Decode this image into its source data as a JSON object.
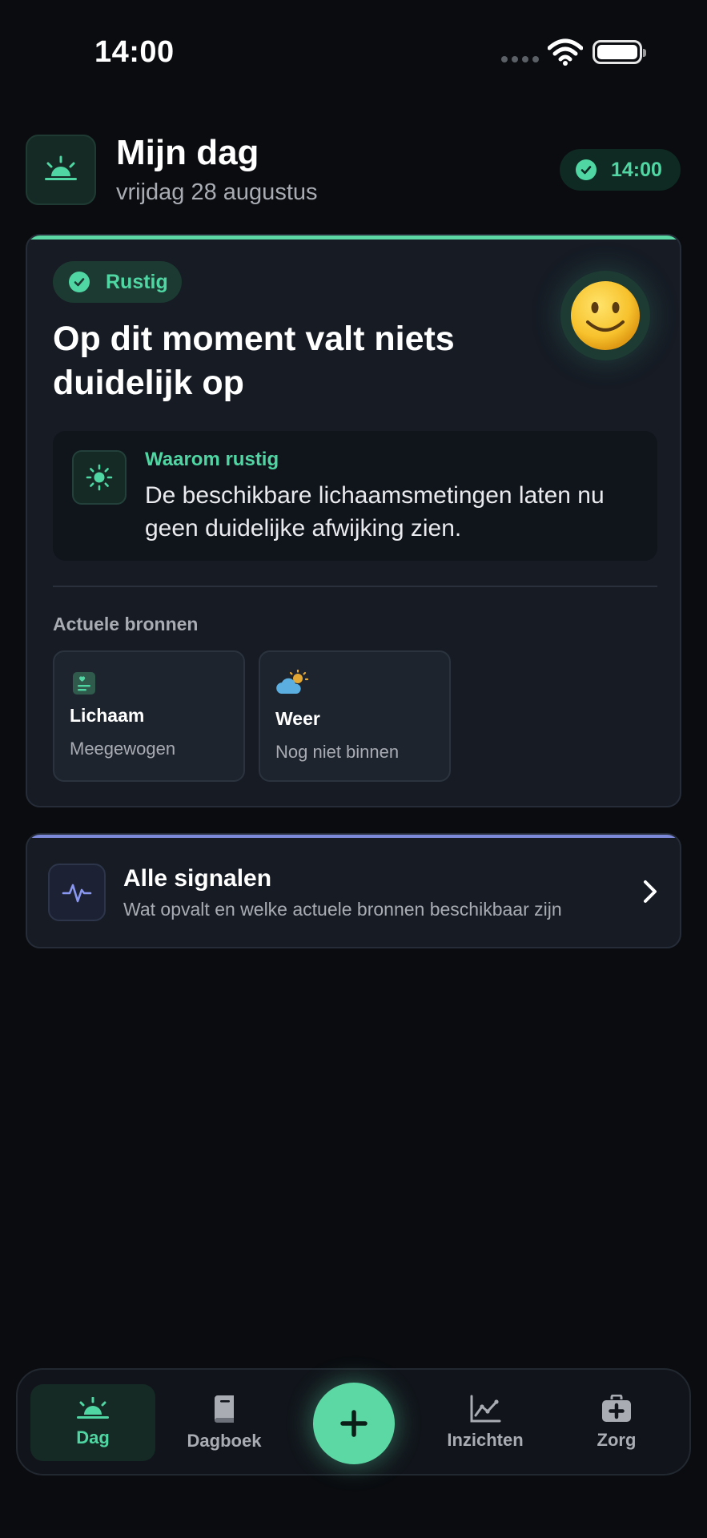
{
  "status_bar": {
    "time": "14:00"
  },
  "header": {
    "title": "Mijn dag",
    "date": "vrijdag 28 augustus",
    "time_badge": "14:00",
    "icon": "sunrise-icon"
  },
  "status_card": {
    "badge": "Rustig",
    "headline": "Op dit moment valt niets duidelijk op",
    "emoji": "🙂",
    "accent_color": "#5cd8a5",
    "why": {
      "title": "Waarom rustig",
      "text": "De beschikbare lichaamsmetingen laten nu geen duidelijke afwijking zien.",
      "icon": "sun-icon"
    },
    "sources_label": "Actuele bronnen",
    "sources": [
      {
        "title": "Lichaam",
        "status": "Meegewogen",
        "icon": "heart-note-icon"
      },
      {
        "title": "Weer",
        "status": "Nog niet binnen",
        "icon": "cloud-sun-icon"
      }
    ]
  },
  "signals_card": {
    "title": "Alle signalen",
    "subtitle": "Wat opvalt en welke actuele bronnen beschikbaar zijn",
    "icon": "pulse-icon",
    "accent_color": "#7c88d8"
  },
  "bottom_nav": {
    "items": [
      {
        "label": "Dag",
        "icon": "sunrise-icon",
        "active": true
      },
      {
        "label": "Dagboek",
        "icon": "book-icon",
        "active": false
      },
      {
        "label": "Inzichten",
        "icon": "chart-icon",
        "active": false
      },
      {
        "label": "Zorg",
        "icon": "medical-kit-icon",
        "active": false
      }
    ],
    "add_icon": "plus-icon"
  }
}
